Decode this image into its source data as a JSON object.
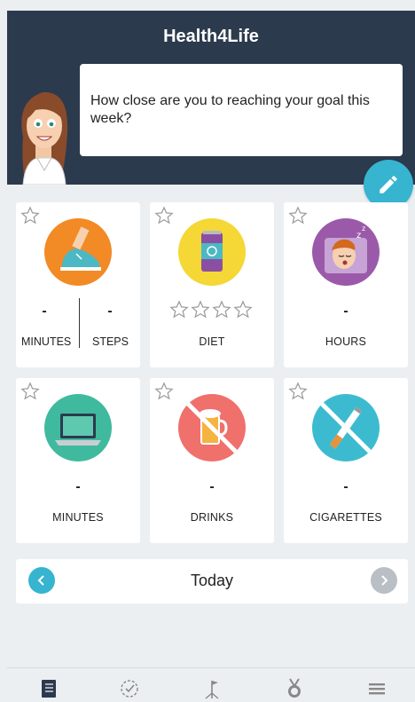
{
  "app": {
    "title": "Health4Life"
  },
  "coach": {
    "message": "How close are you to reaching your goal this week?"
  },
  "cards": [
    {
      "icon": "sneaker-icon",
      "color": "#f28a25",
      "left_value": "-",
      "left_label": "MINUTES",
      "right_value": "-",
      "right_label": "STEPS"
    },
    {
      "icon": "soda-can-icon",
      "color": "#f5d735",
      "label": "DIET",
      "rating": 0,
      "rating_max": 4
    },
    {
      "icon": "sleeping-person-icon",
      "color": "#9b5aa9",
      "value": "-",
      "label": "HOURS"
    },
    {
      "icon": "laptop-icon",
      "color": "#3fba9e",
      "value": "-",
      "label": "MINUTES"
    },
    {
      "icon": "no-beer-icon",
      "color": "#f0706c",
      "value": "-",
      "label": "DRINKS"
    },
    {
      "icon": "no-cigarette-icon",
      "color": "#3cbbd0",
      "value": "-",
      "label": "CIGARETTES"
    }
  ],
  "date_nav": {
    "label": "Today"
  },
  "colors": {
    "header": "#2c3a4e",
    "accent": "#36b4d0",
    "disabled": "#b9bfc5"
  },
  "tabs": [
    "journal-icon",
    "check-progress-icon",
    "goal-flag-icon",
    "medal-icon",
    "menu-icon"
  ]
}
